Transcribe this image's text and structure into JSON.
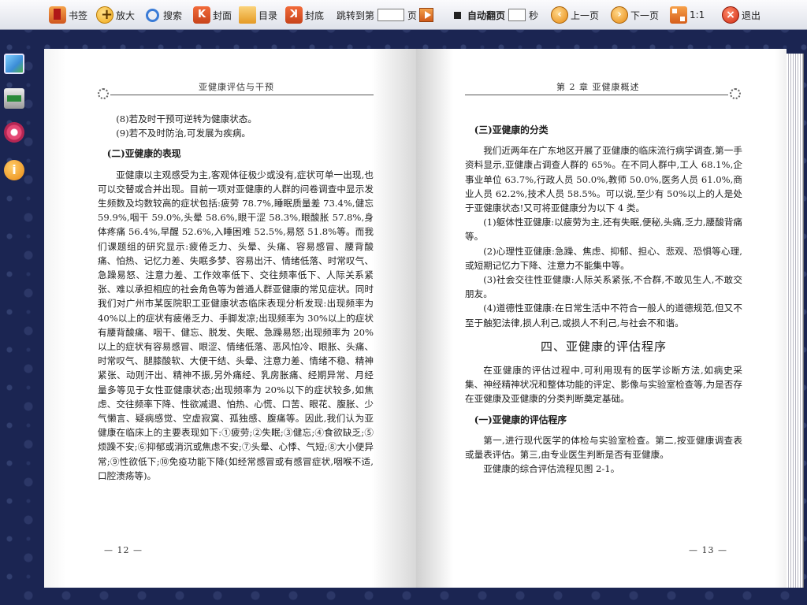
{
  "toolbar": {
    "bookmark": "书签",
    "zoom": "放大",
    "search": "搜索",
    "cover": "封面",
    "contents": "目录",
    "back_cover": "封底",
    "jump_to": "跳转到第",
    "page_unit": "页",
    "auto_flip": "自动翻页",
    "seconds_unit": "秒",
    "prev_page": "上一页",
    "next_page": "下一页",
    "ratio": "1:1",
    "exit": "退出",
    "cover_glyph": "K",
    "back_glyph": "K",
    "info_glyph": "i"
  },
  "left_page": {
    "running_head": "亚健康评估与干预",
    "page_number": "— 12 —",
    "lines": [
      "(8)若及时干预可逆转为健康状态。",
      "(9)若不及时防治,可发展为疾病。"
    ],
    "heading": "(二)亚健康的表现",
    "body": "亚健康以主观感受为主,客观体征极少或没有,症状可单一出现,也可以交替或合并出现。目前一项对亚健康的人群的问卷调查中显示发生频数及均数较高的症状包括:疲劳 78.7%,睡眠质量差 73.4%,健忘 59.9%,咽干 59.0%,头晕 58.6%,眼干涩 58.3%,眼酸胀 57.8%,身体疼痛 56.4%,早醒 52.6%,入睡困难 52.5%,易怒 51.8%等。而我们课题组的研究显示:疲倦乏力、头晕、头痛、容易感冒、腰背酸痛、怕热、记忆力差、失眠多梦、容易出汗、情绪低落、时常叹气、急躁易怒、注意力差、工作效率低下、交往频率低下、人际关系紧张、难以承担相应的社会角色等为普通人群亚健康的常见症状。同时我们对广州市某医院职工亚健康状态临床表现分析发现:出现频率为 40%以上的症状有疲倦乏力、手脚发凉;出现频率为 30%以上的症状有腰背酸痛、咽干、健忘、脱发、失眠、急躁易怒;出现频率为 20%以上的症状有容易感冒、眼涩、情绪低落、恶风怕冷、眼胀、头痛、时常叹气、腿膝酸软、大便干结、头晕、注意力差、情绪不稳、精神紧张、动则汗出、精神不振,另外痛经、乳房胀痛、经期异常、月经量多等见于女性亚健康状态;出现频率为 20%以下的症状较多,如焦虑、交往频率下降、性欲减退、怕热、心慌、口苦、眼花、腹胀、少气懒言、疑病感觉、空虚寂寞、孤独感、腹痛等。因此,我们认为亚健康在临床上的主要表现如下:①疲劳;②失眠;③健忘;④食欲缺乏;⑤烦躁不安;⑥抑郁或消沉或焦虑不安;⑦头晕、心悸、气短;⑧大小便异常;⑨性欲低下;⑩免疫功能下降(如经常感冒或有感冒症状,咽喉不适,口腔溃疡等)。"
  },
  "right_page": {
    "running_head": "第 2 章   亚健康概述",
    "page_number": "— 13 —",
    "heading1": "(三)亚健康的分类",
    "p1": "我们近两年在广东地区开展了亚健康的临床流行病学调查,第一手资料显示,亚健康占调查人群的 65%。在不同人群中,工人 68.1%,企事业单位 63.7%,行政人员 50.0%,教师 50.0%,医务人员 61.0%,商业人员 62.2%,技术人员 58.5%。可以说,至少有 50%以上的人是处于亚健康状态!又可将亚健康分为以下 4 类。",
    "items": [
      "(1)躯体性亚健康:以疲劳为主,还有失眠,便秘,头痛,乏力,腰酸背痛等。",
      "(2)心理性亚健康:急躁、焦虑、抑郁、担心、悲观、恐惧等心理,或短期记忆力下降、注意力不能集中等。",
      "(3)社会交往性亚健康:人际关系紧张,不合群,不敢见生人,不敢交朋友。",
      "(4)道德性亚健康:在日常生活中不符合一般人的道德规范,但又不至于触犯法律,损人利己,或损人不利己,与社会不和谐。"
    ],
    "chapter_heading": "四、亚健康的评估程序",
    "p2": "在亚健康的评估过程中,可利用现有的医学诊断方法,如病史采集、神经精神状况和整体功能的评定、影像与实验室检查等,为是否存在亚健康及亚健康的分类判断奠定基础。",
    "heading2": "(一)亚健康的评估程序",
    "p3": "第一,进行现代医学的体检与实验室检查。第二,按亚健康调查表或量表评估。第三,由专业医生判断是否有亚健康。",
    "p4": "亚健康的综合评估流程见图 2-1。"
  }
}
